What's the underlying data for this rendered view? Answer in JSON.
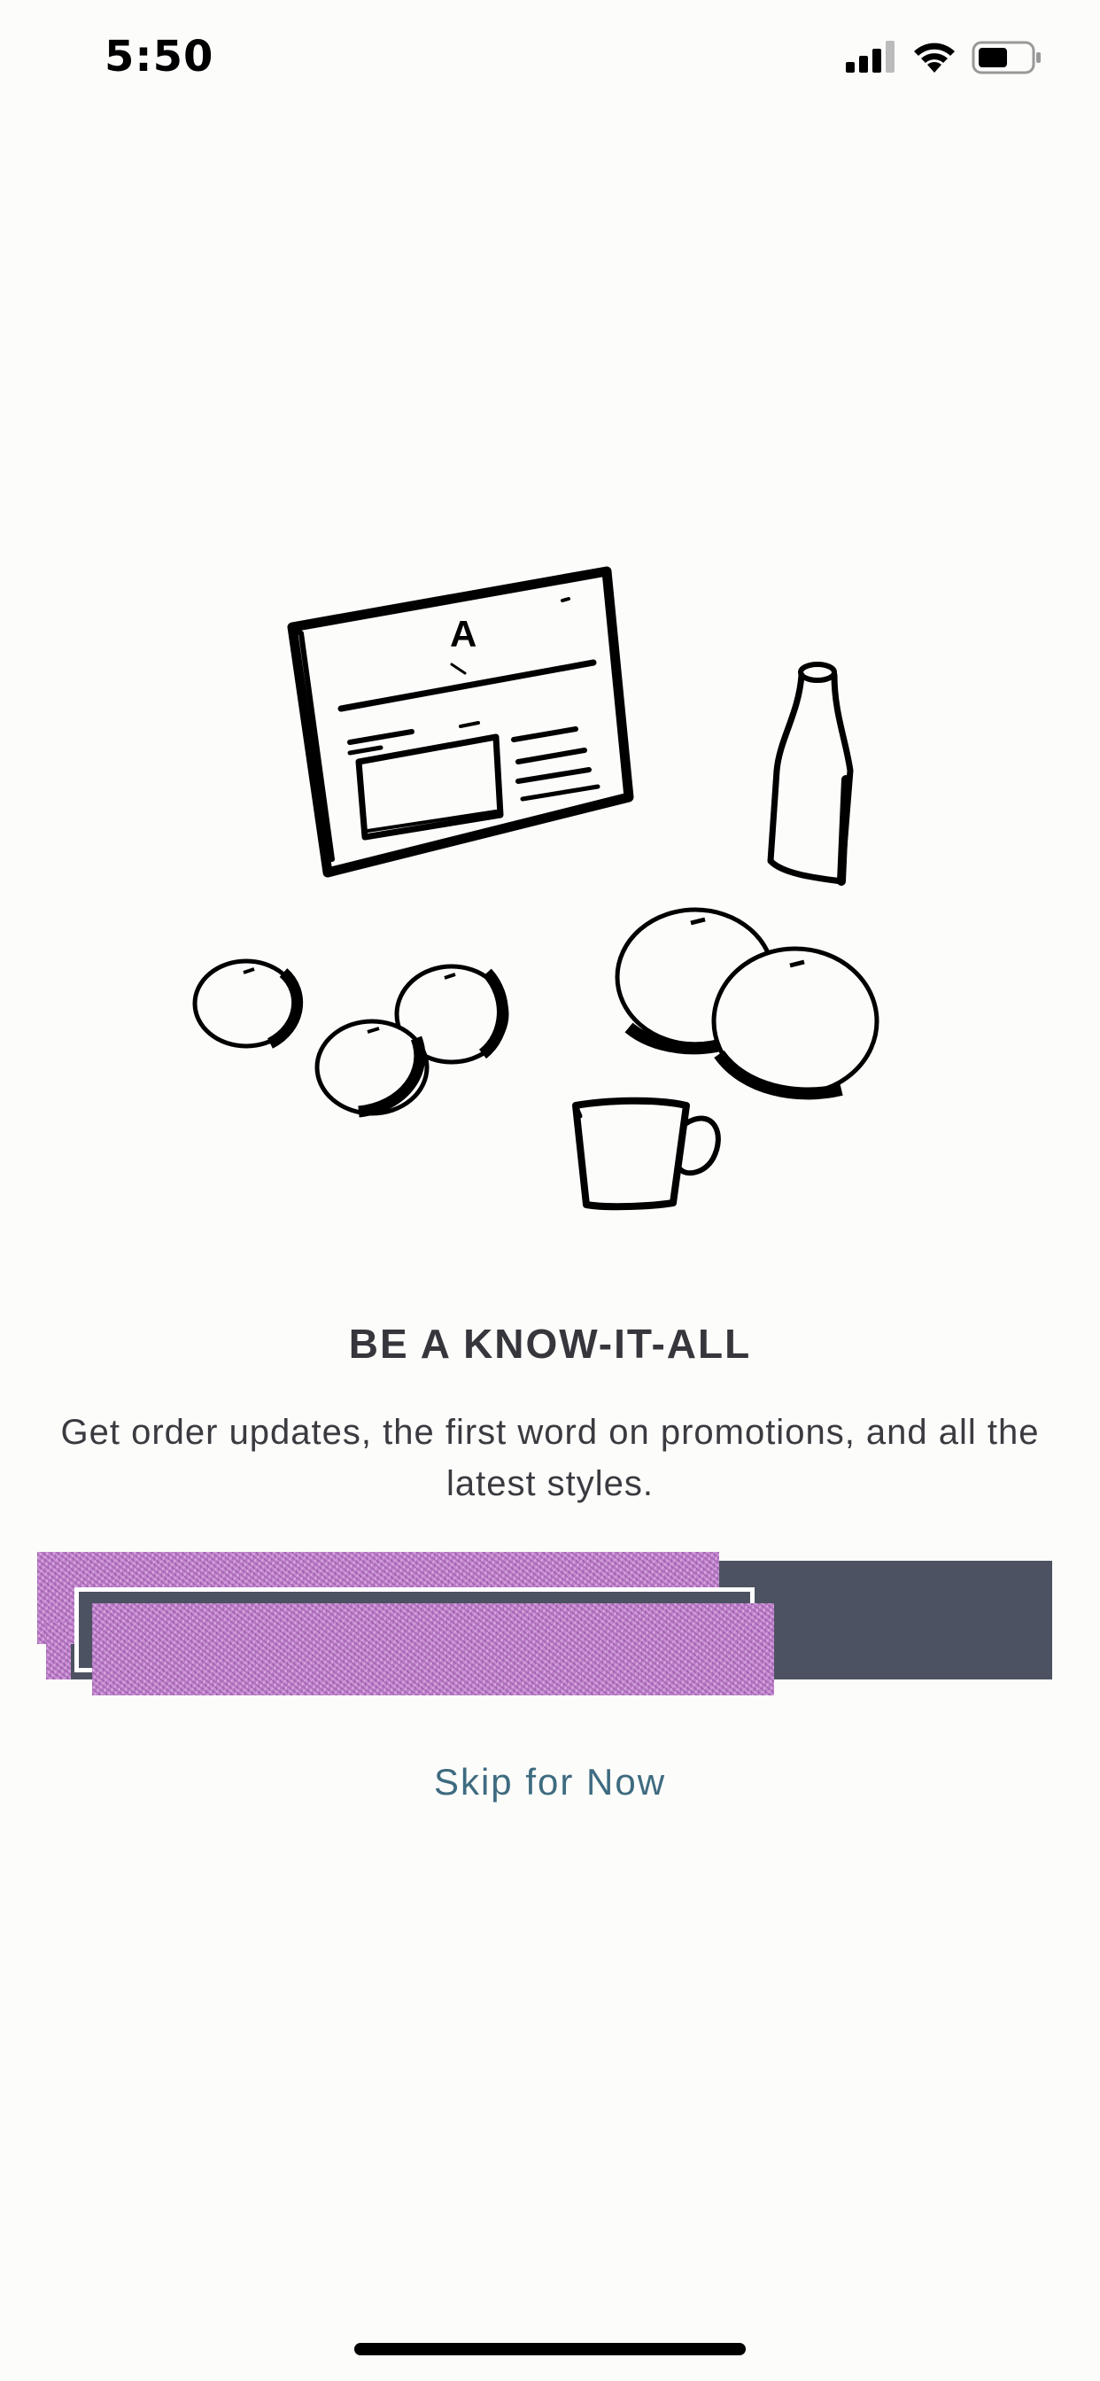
{
  "status_bar": {
    "time": "5:50",
    "icons": [
      "signal-icon",
      "wifi-icon",
      "battery-icon"
    ]
  },
  "illustration": {
    "icon": "still-life-illustration",
    "card_letter": "A"
  },
  "onboarding": {
    "heading": "BE A KNOW-IT-ALL",
    "subtext": "Get order updates, the first word on promotions, and all the latest styles.",
    "skip_label": "Skip for Now"
  },
  "colors": {
    "background": "#fcfcfa",
    "button": "#4c5261",
    "skip_link": "#3e6b80",
    "text": "#36363c"
  }
}
